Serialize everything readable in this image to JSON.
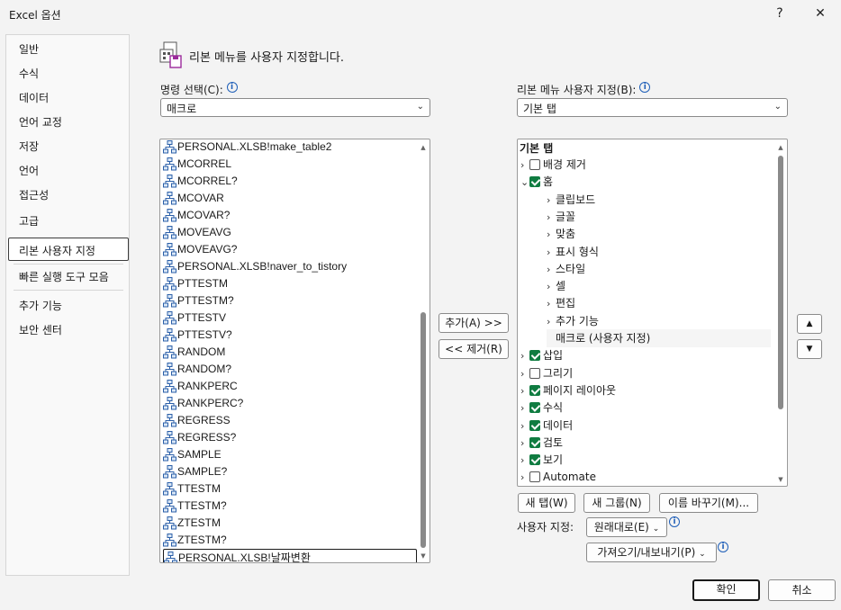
{
  "window": {
    "title": "Excel 옵션",
    "help": "?",
    "close": "✕"
  },
  "nav": {
    "items": [
      "일반",
      "수식",
      "데이터",
      "언어 교정",
      "저장",
      "언어",
      "접근성",
      "고급",
      "리본 사용자 지정",
      "빠른 실행 도구 모음",
      "추가 기능",
      "보안 센터"
    ],
    "selected": "리본 사용자 지정"
  },
  "header": {
    "text": "리본 메뉴를 사용자 지정합니다."
  },
  "left": {
    "label": "명령 선택(C):",
    "combo_value": "매크로",
    "commands": [
      "PERSONAL.XLSB!make_table2",
      "MCORREL",
      "MCORREL?",
      "MCOVAR",
      "MCOVAR?",
      "MOVEAVG",
      "MOVEAVG?",
      "PERSONAL.XLSB!naver_to_tistory",
      "PTTESTM",
      "PTTESTM?",
      "PTTESTV",
      "PTTESTV?",
      "RANDOM",
      "RANDOM?",
      "RANKPERC",
      "RANKPERC?",
      "REGRESS",
      "REGRESS?",
      "SAMPLE",
      "SAMPLE?",
      "TTESTM",
      "TTESTM?",
      "ZTESTM",
      "ZTESTM?",
      "PERSONAL.XLSB!날짜변환"
    ],
    "selected_index": 24
  },
  "middle": {
    "add": "추가(A) >>",
    "remove": "<< 제거(R)"
  },
  "right": {
    "label": "리본 메뉴 사용자 지정(B):",
    "combo_value": "기본 탭",
    "tree_header": "기본 탭",
    "tree": [
      {
        "label": "배경 제거",
        "level": 0,
        "checkbox": true,
        "checked": false,
        "expander": ">"
      },
      {
        "label": "홈",
        "level": 0,
        "checkbox": true,
        "checked": true,
        "expander": "v"
      },
      {
        "label": "클립보드",
        "level": 1,
        "checkbox": false,
        "expander": ">"
      },
      {
        "label": "글꼴",
        "level": 1,
        "checkbox": false,
        "expander": ">"
      },
      {
        "label": "맞춤",
        "level": 1,
        "checkbox": false,
        "expander": ">"
      },
      {
        "label": "표시 형식",
        "level": 1,
        "checkbox": false,
        "expander": ">"
      },
      {
        "label": "스타일",
        "level": 1,
        "checkbox": false,
        "expander": ">"
      },
      {
        "label": "셀",
        "level": 1,
        "checkbox": false,
        "expander": ">"
      },
      {
        "label": "편집",
        "level": 1,
        "checkbox": false,
        "expander": ">"
      },
      {
        "label": "추가 기능",
        "level": 1,
        "checkbox": false,
        "expander": ">"
      },
      {
        "label": "매크로 (사용자 지정)",
        "level": 1,
        "checkbox": false,
        "expander": "",
        "highlight": true
      },
      {
        "label": "삽입",
        "level": 0,
        "checkbox": true,
        "checked": true,
        "expander": ">"
      },
      {
        "label": "그리기",
        "level": 0,
        "checkbox": true,
        "checked": false,
        "expander": ">"
      },
      {
        "label": "페이지 레이아웃",
        "level": 0,
        "checkbox": true,
        "checked": true,
        "expander": ">"
      },
      {
        "label": "수식",
        "level": 0,
        "checkbox": true,
        "checked": true,
        "expander": ">"
      },
      {
        "label": "데이터",
        "level": 0,
        "checkbox": true,
        "checked": true,
        "expander": ">"
      },
      {
        "label": "검토",
        "level": 0,
        "checkbox": true,
        "checked": true,
        "expander": ">"
      },
      {
        "label": "보기",
        "level": 0,
        "checkbox": true,
        "checked": true,
        "expander": ">"
      },
      {
        "label": "Automate",
        "level": 0,
        "checkbox": true,
        "checked": false,
        "expander": ">"
      }
    ],
    "new_tab": "새 탭(W)",
    "new_group": "새 그룹(N)",
    "rename": "이름 바꾸기(M)...",
    "customize_label": "사용자 지정:",
    "reset": "원래대로(E)",
    "import_export": "가져오기/내보내기(P)",
    "move_up": "▲",
    "move_down": "▼"
  },
  "footer": {
    "ok": "확인",
    "cancel": "취소"
  }
}
